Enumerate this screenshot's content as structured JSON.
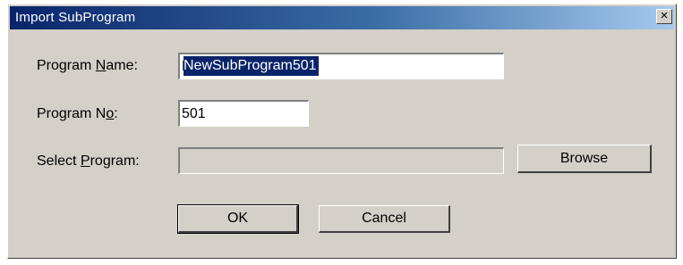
{
  "window": {
    "title": "Import SubProgram",
    "close_label": "×"
  },
  "form": {
    "program_name": {
      "label_pre": "Program ",
      "label_accel": "N",
      "label_post": "ame:",
      "value": "NewSubProgram501"
    },
    "program_no": {
      "label_pre": "Program N",
      "label_accel": "o",
      "label_post": ":",
      "value": "501"
    },
    "select_program": {
      "label_pre": "Select ",
      "label_accel": "P",
      "label_post": "rogram:",
      "value": ""
    }
  },
  "buttons": {
    "browse": "Browse",
    "ok": "OK",
    "cancel": "Cancel"
  }
}
